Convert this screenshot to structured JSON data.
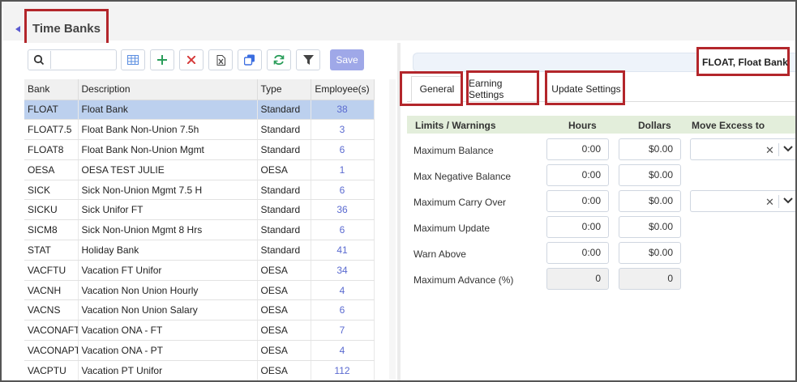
{
  "page": {
    "title": "Time Banks"
  },
  "toolbar": {
    "search_placeholder": "",
    "save_label": "Save"
  },
  "grid": {
    "columns": [
      "Bank",
      "Description",
      "Type",
      "Employee(s)"
    ],
    "rows": [
      {
        "bank": "FLOAT",
        "description": "Float Bank",
        "type": "Standard",
        "employees": "38",
        "selected": true
      },
      {
        "bank": "FLOAT7.5",
        "description": "Float Bank Non-Union 7.5h",
        "type": "Standard",
        "employees": "3"
      },
      {
        "bank": "FLOAT8",
        "description": "Float Bank Non-Union Mgmt",
        "type": "Standard",
        "employees": "6"
      },
      {
        "bank": "OESA",
        "description": "OESA TEST JULIE",
        "type": "OESA",
        "employees": "1"
      },
      {
        "bank": "SICK",
        "description": "Sick Non-Union Mgmt 7.5 H",
        "type": "Standard",
        "employees": "6"
      },
      {
        "bank": "SICKU",
        "description": "Sick Unifor FT",
        "type": "Standard",
        "employees": "36"
      },
      {
        "bank": "SICM8",
        "description": "Sick Non-Union Mgmt 8 Hrs",
        "type": "Standard",
        "employees": "6"
      },
      {
        "bank": "STAT",
        "description": "Holiday Bank",
        "type": "Standard",
        "employees": "41"
      },
      {
        "bank": "VACFTU",
        "description": "Vacation FT Unifor",
        "type": "OESA",
        "employees": "34"
      },
      {
        "bank": "VACNH",
        "description": "Vacation Non Union Hourly",
        "type": "OESA",
        "employees": "4"
      },
      {
        "bank": "VACNS",
        "description": "Vacation Non Union Salary",
        "type": "OESA",
        "employees": "6"
      },
      {
        "bank": "VACONAFT",
        "description": "Vacation ONA - FT",
        "type": "OESA",
        "employees": "7"
      },
      {
        "bank": "VACONAPT",
        "description": "Vacation ONA - PT",
        "type": "OESA",
        "employees": "4"
      },
      {
        "bank": "VACPTU",
        "description": "Vacation PT Unifor",
        "type": "OESA",
        "employees": "112"
      }
    ]
  },
  "detail": {
    "record_label": "FLOAT, Float Bank",
    "tabs": [
      "General",
      "Earning Settings",
      "Update Settings"
    ],
    "active_tab": "General",
    "limits": {
      "headers": {
        "section": "Limits / Warnings",
        "hours": "Hours",
        "dollars": "Dollars",
        "move_excess": "Move Excess to"
      },
      "rows": [
        {
          "label": "Maximum Balance",
          "hours": "0:00",
          "dollars": "$0.00",
          "has_select": true
        },
        {
          "label": "Max Negative Balance",
          "hours": "0:00",
          "dollars": "$0.00",
          "has_select": false
        },
        {
          "label": "Maximum Carry Over",
          "hours": "0:00",
          "dollars": "$0.00",
          "has_select": true
        },
        {
          "label": "Maximum Update",
          "hours": "0:00",
          "dollars": "$0.00",
          "has_select": false
        },
        {
          "label": "Warn Above",
          "hours": "0:00",
          "dollars": "$0.00",
          "has_select": false
        },
        {
          "label": "Maximum Advance (%)",
          "hours": "0",
          "dollars": "0",
          "has_select": false,
          "readonly": true
        }
      ]
    }
  },
  "colors": {
    "accent": "#5a6ad0",
    "highlight_box": "#b3262b",
    "selected_row": "#bcd0ee",
    "section_header": "#e3eedb",
    "save_button": "#9fa8e8"
  },
  "icons": [
    "search-icon",
    "grid-icon",
    "plus-icon",
    "close-icon",
    "export-icon",
    "copy-icon",
    "refresh-icon",
    "filter-icon",
    "chevron-down-icon"
  ]
}
